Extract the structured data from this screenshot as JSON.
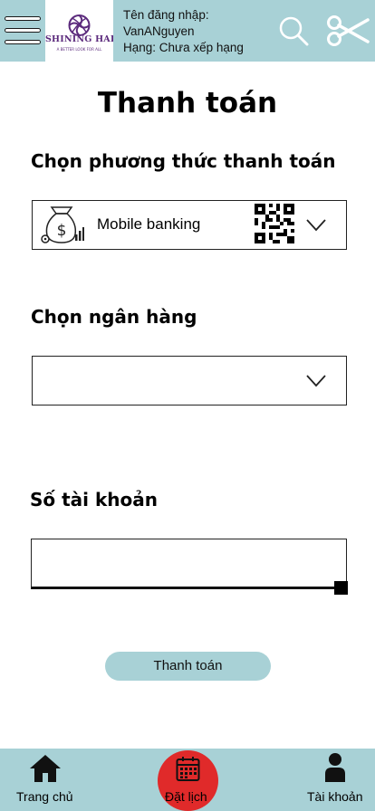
{
  "header": {
    "logo_text": "SHINING HAIR",
    "logo_tagline": "A BETTER LOOK FOR ALL",
    "username_label": "Tên đăng nhập:",
    "username": "VanANguyen",
    "rank": "Hạng: Chưa xếp hạng"
  },
  "page": {
    "title": "Thanh toán"
  },
  "payment_method": {
    "label": "Chọn phương thức thanh toán",
    "selected": "Mobile banking"
  },
  "bank": {
    "label": "Chọn ngân hàng",
    "selected": ""
  },
  "account": {
    "label": "Số tài khoản",
    "value": ""
  },
  "pay_button": "Thanh toán",
  "bottom_nav": {
    "home": "Trang chủ",
    "booking": "Đặt lịch",
    "account": "Tài khoản"
  },
  "colors": {
    "accent": "#a8d1d6",
    "booking": "#e02a2a",
    "logo_purple": "#5b2a7c"
  }
}
